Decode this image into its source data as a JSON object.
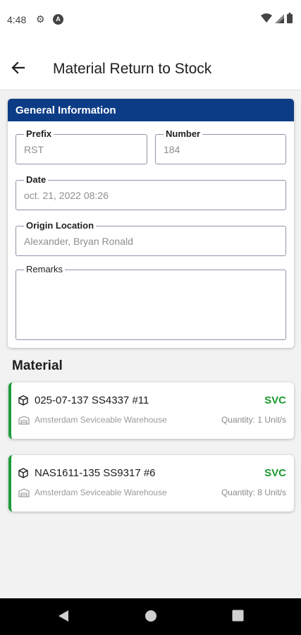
{
  "status_bar": {
    "time": "4:48"
  },
  "app_bar": {
    "title": "Material Return to Stock"
  },
  "general_info": {
    "header": "General Information",
    "prefix": {
      "label": "Prefix",
      "value": "RST"
    },
    "number": {
      "label": "Number",
      "value": "184"
    },
    "date": {
      "label": "Date",
      "value": "oct. 21, 2022 08:26"
    },
    "origin": {
      "label": "Origin Location",
      "value": "Alexander, Bryan Ronald"
    },
    "remarks": {
      "label": "Remarks",
      "value": ""
    }
  },
  "material": {
    "title": "Material",
    "items": [
      {
        "name": "025-07-137 SS4337 #11",
        "status": "SVC",
        "warehouse": "Amsterdam Seviceable Warehouse",
        "quantity": "Quantity: 1 Unit/s"
      },
      {
        "name": "NAS1611-135 SS9317 #6",
        "status": "SVC",
        "warehouse": "Amsterdam Seviceable Warehouse",
        "quantity": "Quantity: 8 Unit/s"
      }
    ]
  },
  "colors": {
    "header_blue": "#0d3c86",
    "status_green": "#1a9a2e",
    "accent_bar": "#1e9c3d"
  }
}
